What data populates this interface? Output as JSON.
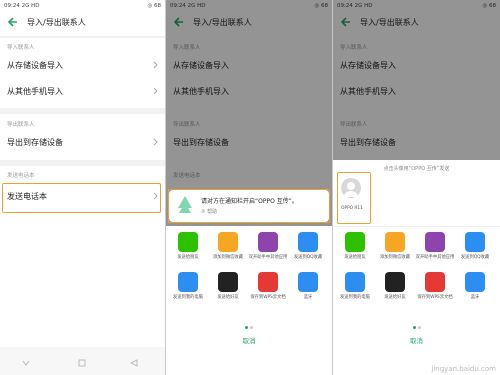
{
  "status": {
    "time": "09:24",
    "signal": "2G HD",
    "right": "◎ 68"
  },
  "header": {
    "title": "导入/导出联系人"
  },
  "import_section": {
    "label": "导入联系人",
    "from_storage": "从存储设备导入",
    "from_phone": "从其他手机导入"
  },
  "export_section": {
    "label": "导出联系人",
    "to_storage": "导出到存储设备"
  },
  "send_section": {
    "label": "发送电话本",
    "send": "发送电话本"
  },
  "share_apps": [
    {
      "label": "发送给朋友",
      "color": "#2dc100",
      "icon": "wechat-icon"
    },
    {
      "label": "添加到微信收藏",
      "color": "#f5a623",
      "icon": "cube-icon"
    },
    {
      "label": "双开助手中其他应用",
      "color": "#8e44ad",
      "icon": "infinity-icon"
    },
    {
      "label": "发送到QQ收藏",
      "color": "#2b8ef0",
      "icon": "star-icon"
    },
    {
      "label": "发送到我的电脑",
      "color": "#2b8ef0",
      "icon": "computer-icon"
    },
    {
      "label": "发送给好友",
      "color": "#222222",
      "icon": "qq-icon"
    },
    {
      "label": "保存到WPS云文档",
      "color": "#e53935",
      "icon": "wps-icon"
    },
    {
      "label": "蓝牙",
      "color": "#2b8ef0",
      "icon": "bluetooth-icon"
    }
  ],
  "cancel_label": "取消",
  "notice": {
    "text": "请对方在通知栏开启“OPPO 互传”。",
    "help": "② 帮助"
  },
  "oppo_share": {
    "hint": "点击头像用“OPPO 互传”发送",
    "device": "OPPO R11"
  },
  "watermark": "jingyan.baidu.com"
}
